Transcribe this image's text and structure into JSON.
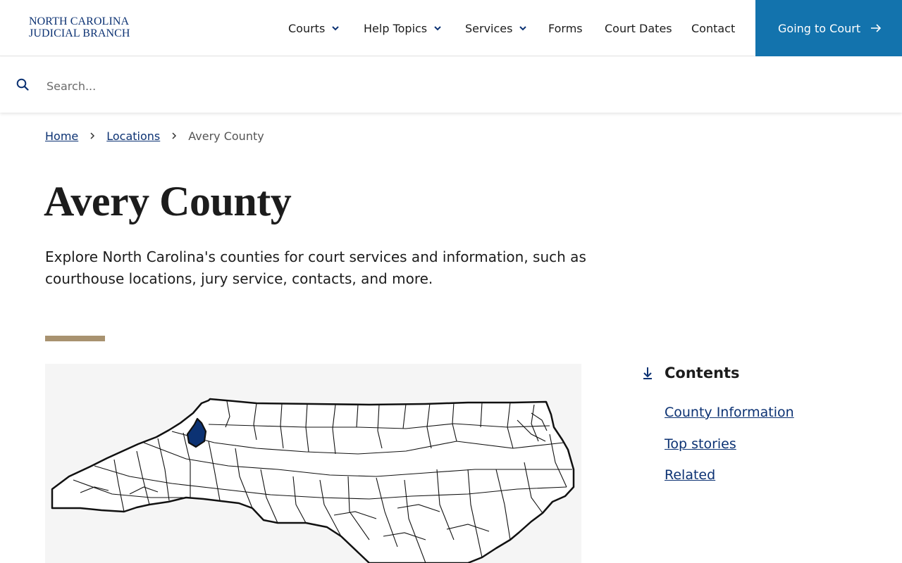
{
  "header": {
    "logo_line1": "NORTH CAROLINA",
    "logo_line2": "JUDICIAL BRANCH",
    "nav": [
      {
        "label": "Courts",
        "has_menu": true
      },
      {
        "label": "Help Topics",
        "has_menu": true
      },
      {
        "label": "Services",
        "has_menu": true
      },
      {
        "label": "Forms",
        "has_menu": false
      },
      {
        "label": "Court Dates",
        "has_menu": false
      },
      {
        "label": "Contact",
        "has_menu": false
      }
    ],
    "cta_label": "Going to Court"
  },
  "search": {
    "placeholder": "Search...",
    "value": ""
  },
  "breadcrumb": {
    "items": [
      "Home",
      "Locations"
    ],
    "current": "Avery County"
  },
  "page": {
    "title": "Avery County",
    "intro": "Explore North Carolina's counties for court services and information, such as courthouse locations, jury service, contacts, and more."
  },
  "map": {
    "highlighted_county": "Avery County",
    "highlight_color": "#0c3273"
  },
  "contents": {
    "title": "Contents",
    "items": [
      "County Information",
      "Top stories",
      "Related"
    ]
  },
  "colors": {
    "brand_navy": "#0c3273",
    "cta_blue": "#1373ad",
    "accent_tan": "#a89270"
  }
}
